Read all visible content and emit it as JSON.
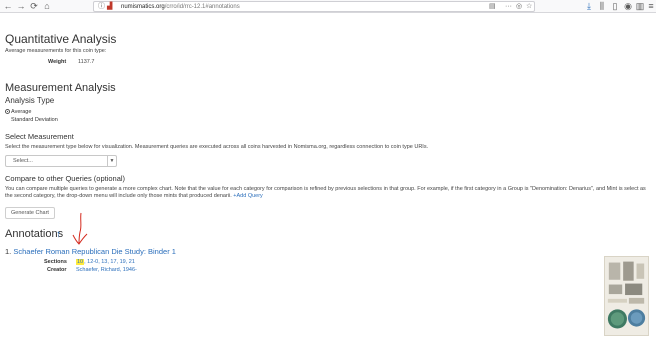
{
  "browser": {
    "url_host": "numismatics.org",
    "url_path": "/crro/id/rrc-12.1#annotations",
    "nav_back": "←",
    "nav_forward": "→",
    "nav_reload": "⟳",
    "nav_home": "⌂",
    "page_actions": "···"
  },
  "quantitative": {
    "title": "Quantitative Analysis",
    "description": "Average measurements for this coin type:",
    "weight_label": "Weight",
    "weight_value": "1137.7"
  },
  "measurement": {
    "title": "Measurement Analysis",
    "analysis_type_title": "Analysis Type",
    "options": [
      {
        "label": "Average",
        "selected": true
      },
      {
        "label": "Standard Deviation",
        "selected": false
      }
    ]
  },
  "select_measurement": {
    "title": "Select Measurement",
    "description": "Select the measurement type below for visualization. Measurement queries are executed across all coins harvested in Nomisma.org, regardless connection to coin type URIs.",
    "select_value": "Select..."
  },
  "compare": {
    "title": "Compare to other Queries (optional)",
    "description": "You can compare multiple queries to generate a more complex chart. Note that the value for each category for comparison is refined by previous selections in that group. For example, if the first category in a Group is \"Denomination: Denarius\", and Mint is select as the second category, the drop-down menu will include only those mints that produced denarii.",
    "add_query_label": "Add Query",
    "add_query_icon": "+",
    "generate_button": "Generate Chart"
  },
  "annotations": {
    "title": "Annotations",
    "title_icon": "↑",
    "items": [
      {
        "number": "1.",
        "title": "Schaefer Roman Republican Die Study: Binder 1",
        "sections_label": "Sections",
        "sections_first": "10",
        "sections_rest": ", 12-0, 13, 17, 19, 21",
        "creator_label": "Creator",
        "creator_value": "Schaefer, Richard, 1946-"
      }
    ]
  },
  "colors": {
    "link": "#2a6ebb",
    "highlight": "#ffeb3b",
    "annotation_pen": "#d42a1e"
  }
}
